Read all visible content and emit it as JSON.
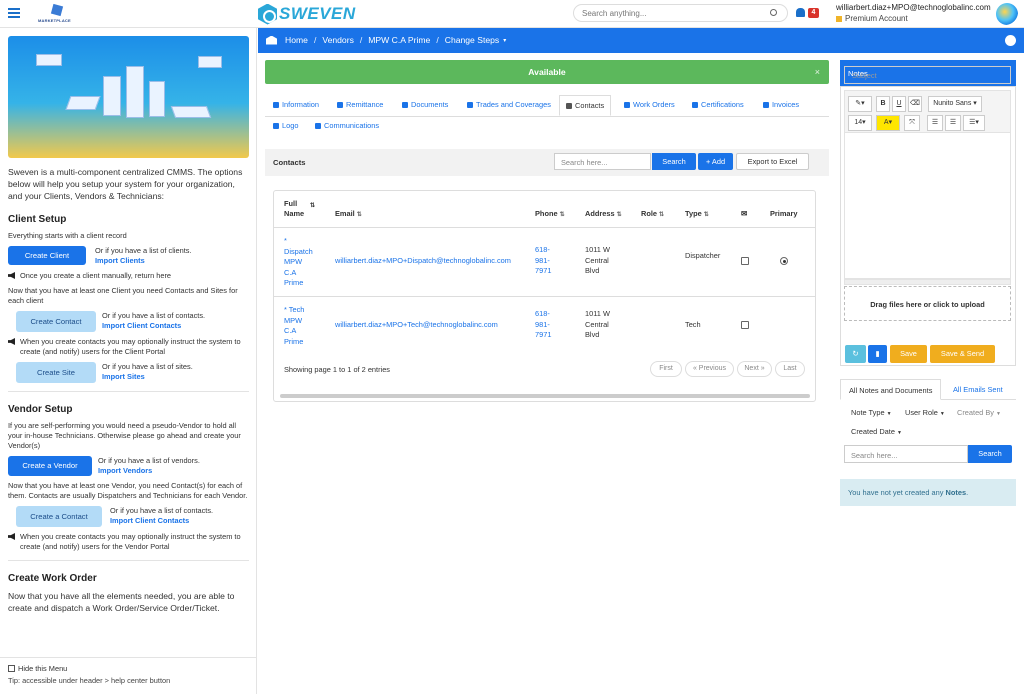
{
  "header": {
    "logo_text": "MARKETPLACE",
    "brand": "SWEVEN",
    "search_placeholder": "Search anything...",
    "notif_count": "4",
    "user_email": "williarbert.diaz+MPO@technoglobalinc.com",
    "user_plan": "Premium Account"
  },
  "breadcrumb": {
    "items": [
      "Home",
      "Vendors",
      "MPW C.A Prime",
      "Change Steps"
    ]
  },
  "alert": {
    "text": "Available",
    "close": "×"
  },
  "tabs": [
    "Information",
    "Remittance",
    "Documents",
    "Trades and Coverages",
    "Contacts",
    "Work Orders",
    "Certifications",
    "Invoices",
    "Logo",
    "Communications"
  ],
  "contacts": {
    "title": "Contacts",
    "search_placeholder": "Search here...",
    "search_btn": "Search",
    "add_btn": "+ Add",
    "export_btn": "Export to Excel",
    "columns": [
      "Full Name",
      "Email",
      "Phone",
      "Address",
      "Role",
      "Type",
      "✉",
      "Primary"
    ],
    "rows": [
      {
        "name": "* Dispatch MPW C.A Prime",
        "email": "williarbert.diaz+MPO+Dispatch@technoglobalinc.com",
        "phone": "618-981-7971",
        "address": "1011 W Central Blvd",
        "role": "",
        "type": "Dispatcher"
      },
      {
        "name": "* Tech MPW C.A Prime",
        "email": "williarbert.diaz+MPO+Tech@technoglobalinc.com",
        "phone": "618-981-7971",
        "address": "1011 W Central Blvd",
        "role": "",
        "type": "Tech"
      }
    ],
    "showing": "Showing page 1 to 1 of 2 entries",
    "pager": [
      "First",
      "« Previous",
      "Next »",
      "Last"
    ]
  },
  "sidebar": {
    "intro": "Sweven is a multi-component centralized CMMS. The options below will help you setup your system for your organization, and your Clients, Vendors & Technicians:",
    "client_setup": {
      "title": "Client Setup",
      "start": "Everything starts with a client record",
      "create_client": "Create Client",
      "or_list_clients": "Or if you have a list of clients.",
      "import_clients": "Import Clients",
      "once_created": "Once you create a client manually, return here",
      "contacts_sites_text": "Now that you have at least one Client you need Contacts and Sites for each client",
      "create_contact": "Create Contact",
      "or_list_contacts": "Or if you have a list of contacts.",
      "import_client_contacts": "Import Client Contacts",
      "notify_text": "When you create contacts you may optionally instruct the system to create (and notify) users for the Client Portal",
      "create_site": "Create Site",
      "or_list_sites": "Or if you have a list of sites.",
      "import_sites": "Import Sites"
    },
    "vendor_setup": {
      "title": "Vendor Setup",
      "intro": "If you are self-performing you would need a pseudo-Vendor to hold all your in-house Technicians. Otherwise please go ahead and create your Vendor(s)",
      "create_vendor": "Create a Vendor",
      "or_list_vendors": "Or if you have a list of vendors.",
      "import_vendors": "Import Vendors",
      "contacts_text": "Now that you have at least one Vendor, you need Contact(s) for each of them. Contacts are usually Dispatchers and Technicians for each Vendor.",
      "create_contact": "Create a Contact",
      "or_list_contacts": "Or if you have a list of contacts.",
      "import_client_contacts": "Import Client Contacts",
      "notify_text": "When you create contacts you may optionally instruct the system to create (and notify) users for the Vendor Portal"
    },
    "work_order": {
      "title": "Create Work Order",
      "text": "Now that you have all the elements needed, you are able to create and dispatch a Work Order/Service Order/Ticket."
    },
    "hide_menu": "Hide this Menu",
    "tip": "Tip: accessible under header > help center button"
  },
  "notes": {
    "title": "Notes",
    "subject_placeholder": "Subject",
    "font_name": "Nunito Sans",
    "font_size": "14",
    "drop_text": "Drag files here or click to upload",
    "save": "Save",
    "save_send": "Save & Send",
    "tab_all": "All Notes and Documents",
    "tab_emails": "All Emails Sent",
    "filters": [
      "Note Type",
      "User Role",
      "Created By",
      "Created Date"
    ],
    "search_placeholder": "Search here...",
    "search_btn": "Search",
    "empty_prefix": "You have not yet created any ",
    "empty_bold": "Notes",
    "empty_suffix": "."
  },
  "colors": {
    "primary": "#1a73e8",
    "success": "#5cb85c",
    "warning": "#f0ad1e",
    "info_bg": "#d9ecf2"
  }
}
